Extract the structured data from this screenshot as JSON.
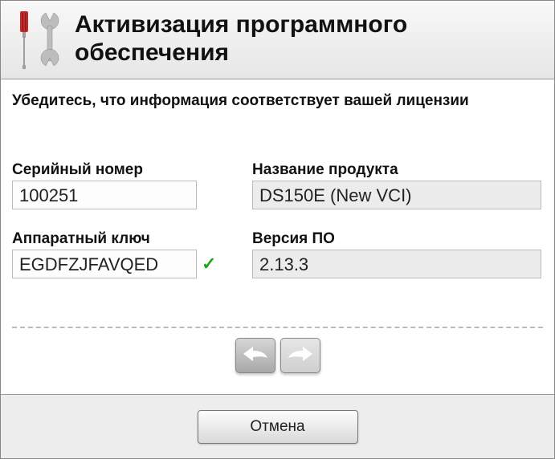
{
  "header": {
    "title": "Активизация программного обеспечения"
  },
  "instruction": "Убедитесь, что информация соответствует вашей лицензии",
  "fields": {
    "serial": {
      "label": "Серийный номер",
      "value": "100251"
    },
    "product": {
      "label": "Название продукта",
      "value": "DS150E (New VCI)"
    },
    "hwkey": {
      "label": "Аппаратный ключ",
      "value": "EGDFZJFAVQED",
      "valid": "✓"
    },
    "version": {
      "label": "Версия ПО",
      "value": "2.13.3"
    }
  },
  "footer": {
    "cancel": "Отмена"
  }
}
